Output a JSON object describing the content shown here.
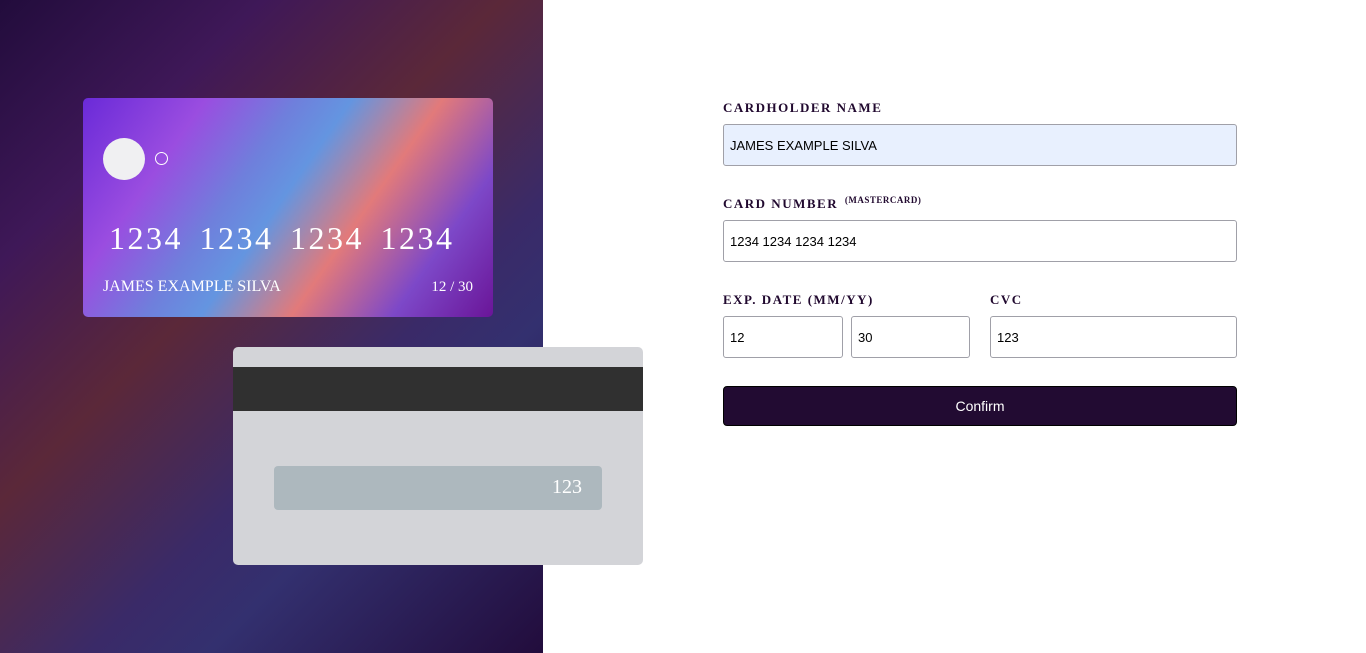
{
  "card_front": {
    "number": "1234 1234 1234 1234",
    "name": "JAMES EXAMPLE SILVA",
    "expiry": "12 / 30"
  },
  "card_back": {
    "cvc": "123"
  },
  "form": {
    "cardholder_label": "CARDHOLDER NAME",
    "cardholder_value": "JAMES EXAMPLE SILVA",
    "card_number_label": "CARD NUMBER",
    "card_brand_note": "(MASTERCARD)",
    "card_number_value": "1234 1234 1234 1234",
    "exp_label": "EXP. DATE (MM/YY)",
    "exp_month_value": "12",
    "exp_year_value": "30",
    "cvc_label": "CVC",
    "cvc_value": "123",
    "confirm_label": "Confirm"
  },
  "colors": {
    "accent_dark": "#220b32",
    "autofill_background": "#e8f0fe",
    "card_back_background": "#d3d4d8",
    "magnetic_stripe": "#303030"
  }
}
